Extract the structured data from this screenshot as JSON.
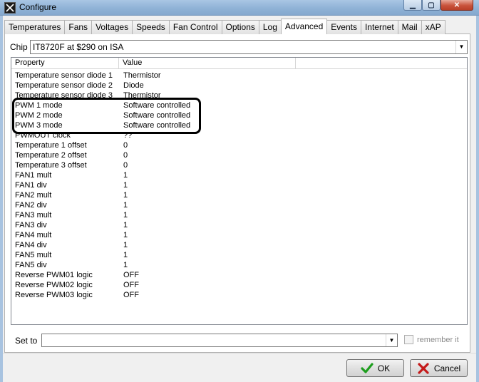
{
  "window": {
    "title": "Configure",
    "icon": "fan-icon",
    "controls": [
      "minimize",
      "maximize",
      "close"
    ]
  },
  "tabs": [
    {
      "label": "Temperatures"
    },
    {
      "label": "Fans"
    },
    {
      "label": "Voltages"
    },
    {
      "label": "Speeds"
    },
    {
      "label": "Fan Control"
    },
    {
      "label": "Options"
    },
    {
      "label": "Log"
    },
    {
      "label": "Advanced",
      "active": true
    },
    {
      "label": "Events"
    },
    {
      "label": "Internet"
    },
    {
      "label": "Mail"
    },
    {
      "label": "xAP"
    }
  ],
  "chip": {
    "label": "Chip",
    "value": "IT8720F at $290 on ISA"
  },
  "table": {
    "columns": [
      "Property",
      "Value"
    ],
    "rows": [
      {
        "property": "Temperature sensor diode 1",
        "value": "Thermistor"
      },
      {
        "property": "Temperature sensor diode 2",
        "value": "Diode"
      },
      {
        "property": "Temperature sensor diode 3",
        "value": "Thermistor"
      },
      {
        "property": "PWM 1 mode",
        "value": "Software controlled"
      },
      {
        "property": "PWM 2 mode",
        "value": "Software controlled"
      },
      {
        "property": "PWM 3 mode",
        "value": "Software controlled"
      },
      {
        "property": "PWMOUT clock",
        "value": "??"
      },
      {
        "property": "Temperature 1 offset",
        "value": "0"
      },
      {
        "property": "Temperature 2 offset",
        "value": "0"
      },
      {
        "property": "Temperature 3 offset",
        "value": "0"
      },
      {
        "property": "FAN1 mult",
        "value": "1"
      },
      {
        "property": "FAN1 div",
        "value": "1"
      },
      {
        "property": "FAN2 mult",
        "value": "1"
      },
      {
        "property": "FAN2 div",
        "value": "1"
      },
      {
        "property": "FAN3 mult",
        "value": "1"
      },
      {
        "property": "FAN3 div",
        "value": "1"
      },
      {
        "property": "FAN4 mult",
        "value": "1"
      },
      {
        "property": "FAN4 div",
        "value": "1"
      },
      {
        "property": "FAN5 mult",
        "value": "1"
      },
      {
        "property": "FAN5 div",
        "value": "1"
      },
      {
        "property": "Reverse PWM01 logic",
        "value": "OFF"
      },
      {
        "property": "Reverse PWM02 logic",
        "value": "OFF"
      },
      {
        "property": "Reverse PWM03 logic",
        "value": "OFF"
      }
    ]
  },
  "set_to": {
    "label": "Set to",
    "value": ""
  },
  "remember": {
    "label": "remember it",
    "checked": false
  },
  "buttons": {
    "ok": "OK",
    "cancel": "Cancel"
  },
  "colors": {
    "ok_check": "#1e9e1e",
    "cancel_x": "#c41a1a",
    "annotation": "#000000"
  }
}
